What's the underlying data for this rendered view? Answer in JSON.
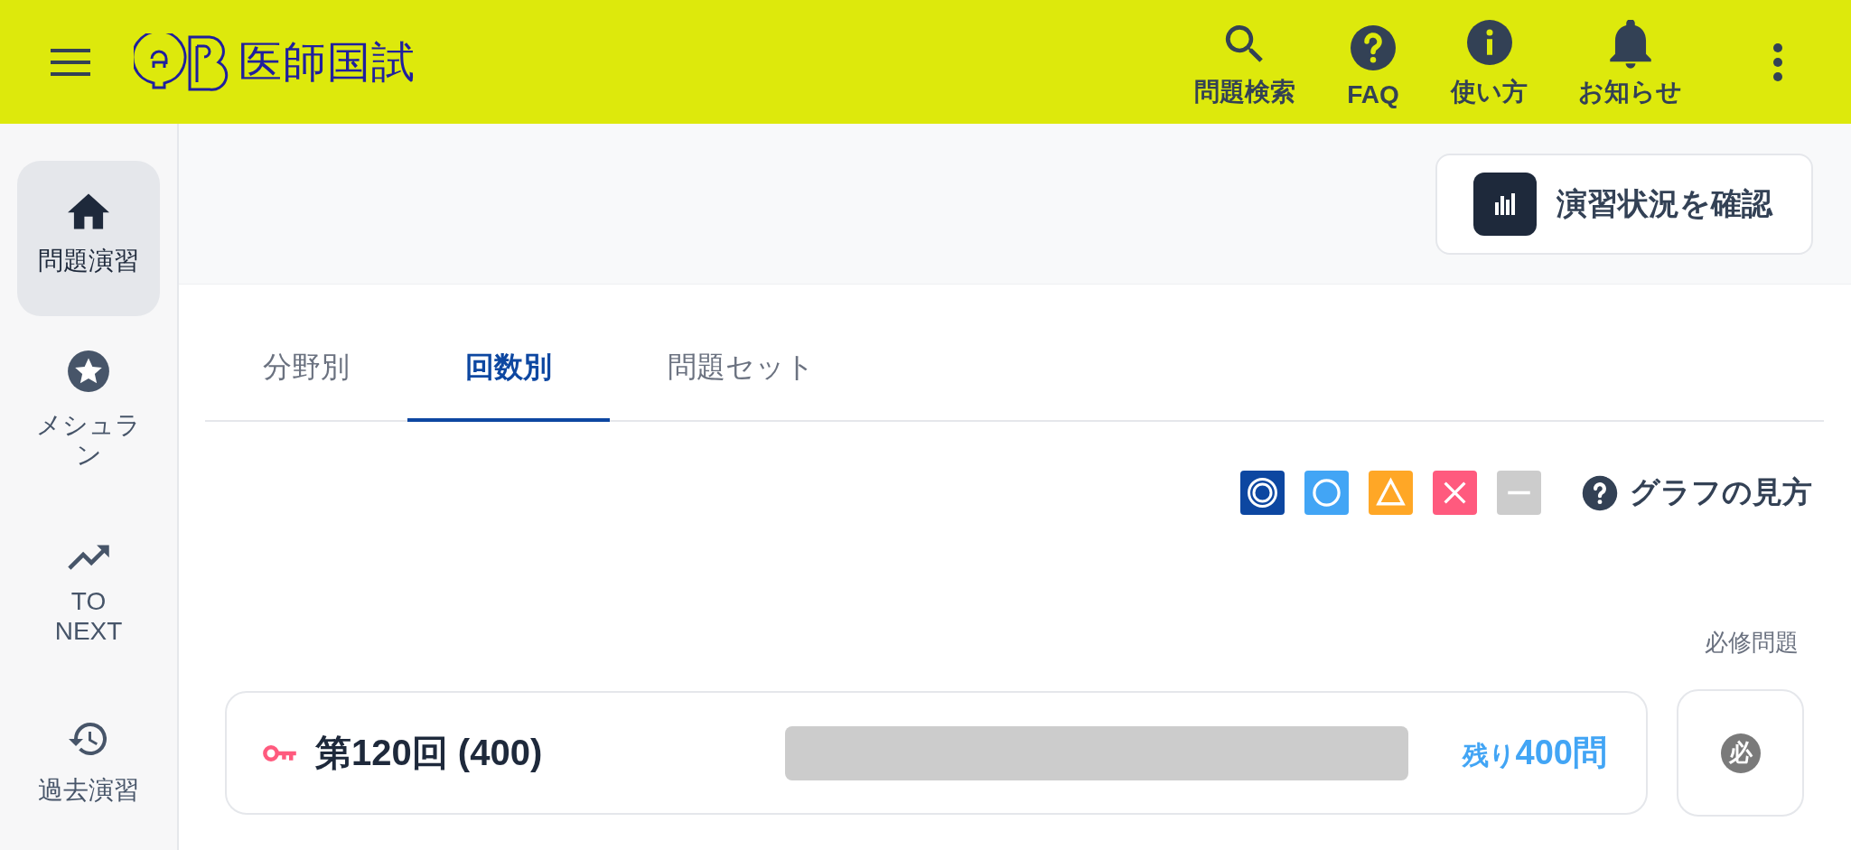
{
  "header": {
    "title": "医師国試",
    "actions": [
      {
        "kind": "search",
        "label": "問題検索"
      },
      {
        "kind": "faq",
        "label": "FAQ"
      },
      {
        "kind": "info",
        "label": "使い方"
      },
      {
        "kind": "bell",
        "label": "お知らせ"
      }
    ]
  },
  "sidebar": {
    "items": [
      {
        "kind": "home",
        "label": "問題演習",
        "selected": true
      },
      {
        "kind": "star",
        "label": "メシュラン",
        "selected": false
      },
      {
        "kind": "trend",
        "label": "TO NEXT",
        "selected": false
      },
      {
        "kind": "history",
        "label": "過去演習",
        "selected": false
      }
    ]
  },
  "status_button": {
    "label": "演習状況を確認"
  },
  "tabs": [
    {
      "label": "分野別",
      "selected": false
    },
    {
      "label": "回数別",
      "selected": true
    },
    {
      "label": "問題セット",
      "selected": false
    }
  ],
  "legend": {
    "items": [
      {
        "kind": "double-circle",
        "color": "#0d47a1"
      },
      {
        "kind": "circle",
        "color": "#42a5f5"
      },
      {
        "kind": "triangle",
        "color": "#ffa726"
      },
      {
        "kind": "cross",
        "color": "#ff5a7e"
      },
      {
        "kind": "dash",
        "color": "#cccccc"
      }
    ],
    "help_label": "グラフの見方"
  },
  "section_label": "必修問題",
  "rounds": [
    {
      "title": "第120回 (400)",
      "segments": [
        {
          "color": "#cccccc",
          "level": 1
        }
      ],
      "remaining_prefix": "残り",
      "remaining_count": "400問",
      "must_label": "必"
    }
  ]
}
